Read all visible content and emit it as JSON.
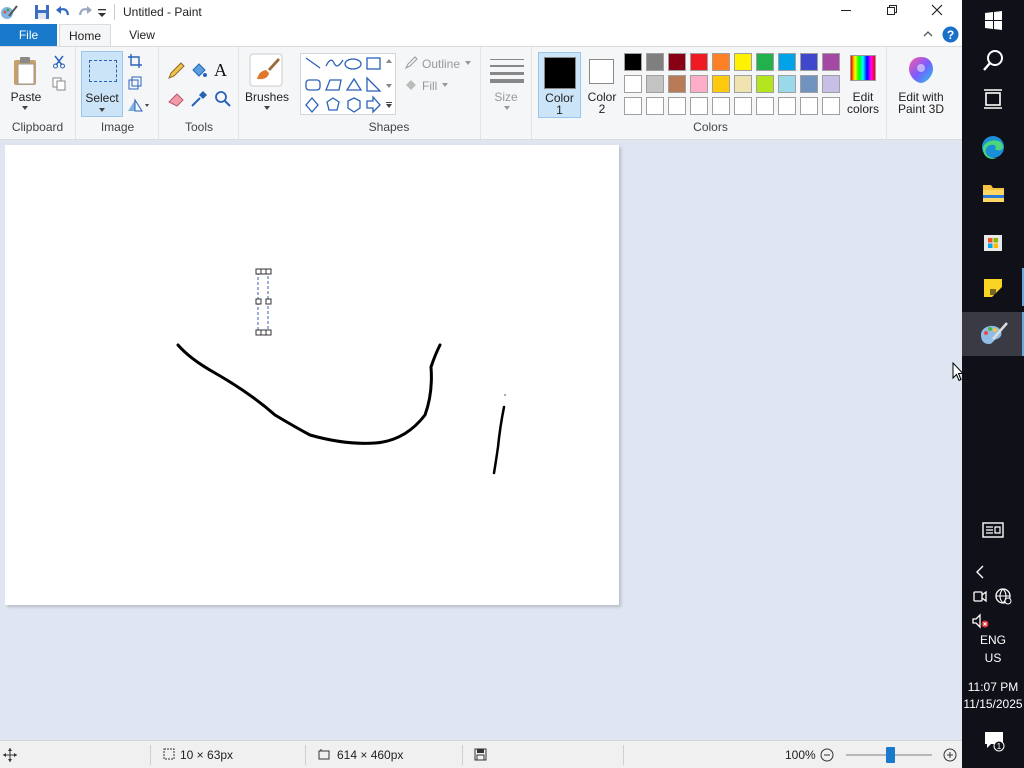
{
  "window": {
    "title": "Untitled - Paint"
  },
  "tabs": {
    "file": "File",
    "home": "Home",
    "view": "View"
  },
  "ribbon": {
    "clipboard": {
      "paste": "Paste",
      "group": "Clipboard"
    },
    "image": {
      "select": "Select",
      "group": "Image"
    },
    "tools": {
      "group": "Tools",
      "text_tool": "A"
    },
    "brushes": {
      "label": "Brushes"
    },
    "shapes": {
      "outline": "Outline",
      "fill": "Fill",
      "group": "Shapes"
    },
    "size": {
      "label": "Size"
    },
    "color1": {
      "line1": "Color",
      "line2": "1"
    },
    "color2": {
      "line1": "Color",
      "line2": "2"
    },
    "colors": {
      "group": "Colors",
      "edit_line1": "Edit",
      "edit_line2": "colors"
    },
    "paint3d": {
      "line1": "Edit with",
      "line2": "Paint 3D"
    }
  },
  "palette": {
    "row1": [
      "#000000",
      "#7f7f7f",
      "#880015",
      "#ed1c24",
      "#ff7f27",
      "#fff200",
      "#22b14c",
      "#00a2e8",
      "#3f48cc",
      "#a349a4"
    ],
    "row2": [
      "#ffffff",
      "#c3c3c3",
      "#b97a57",
      "#ffaec9",
      "#ffc90e",
      "#efe4b0",
      "#b5e61d",
      "#99d9ea",
      "#7092be",
      "#c8bfe7"
    ],
    "row3": [
      "#ffffff",
      "#ffffff",
      "#ffffff",
      "#ffffff",
      "#ffffff",
      "#ffffff",
      "#ffffff",
      "#ffffff",
      "#ffffff",
      "#ffffff"
    ]
  },
  "status": {
    "selection_size": "10 × 63px",
    "canvas_size": "614 × 460px",
    "zoom": "100%",
    "zoom_fraction": 0.51
  },
  "taskbar": {
    "lang1": "ENG",
    "lang2": "US",
    "time": "11:07 PM",
    "date": "11/15/2025"
  }
}
